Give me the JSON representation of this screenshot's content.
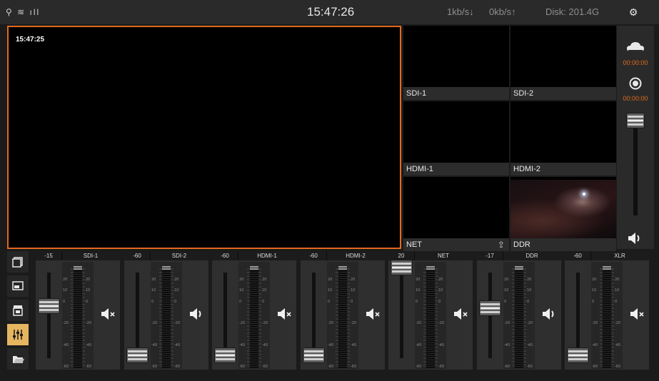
{
  "status_bar": {
    "clock": "15:47:26",
    "download": "1kb/s↓",
    "upload": "0kb/s↑",
    "disk": "Disk: 201.4G",
    "left_icons": "⚲ ≋ ıll"
  },
  "program": {
    "timestamp": "15:47:25",
    "border_color": "#e06a1f"
  },
  "sources": [
    {
      "label": "SDI-1"
    },
    {
      "label": "SDI-2"
    },
    {
      "label": "HDMI-1"
    },
    {
      "label": "HDMI-2"
    },
    {
      "label": "NET",
      "icon": "upload-icon"
    },
    {
      "label": "DDR"
    }
  ],
  "right_panel": {
    "stream_time": "00:00:00",
    "record_time": "00:00:00",
    "master_volume": "unmuted"
  },
  "tools": [
    {
      "icon": "multiview-icon"
    },
    {
      "icon": "pip-icon"
    },
    {
      "icon": "clapper-icon"
    },
    {
      "icon": "mixer-icon",
      "active": true
    },
    {
      "icon": "folder-icon"
    }
  ],
  "mixer": {
    "scale_labels": [
      "20",
      "10",
      "0",
      "-20",
      "-40",
      "-60"
    ],
    "channels": [
      {
        "name": "SDI-1",
        "level": "-15",
        "fader": -15,
        "muted": true
      },
      {
        "name": "SDI-2",
        "level": "-60",
        "fader": -60,
        "muted": false
      },
      {
        "name": "HDMI-1",
        "level": "-60",
        "fader": -60,
        "muted": true
      },
      {
        "name": "HDMI-2",
        "level": "-60",
        "fader": -60,
        "muted": true
      },
      {
        "name": "NET",
        "level": "20",
        "fader": 20,
        "muted": true
      },
      {
        "name": "DDR",
        "level": "-17",
        "fader": -17,
        "muted": false
      },
      {
        "name": "XLR",
        "level": "-60",
        "fader": -60,
        "muted": true
      }
    ]
  },
  "colors": {
    "accent": "#e06a1f",
    "active_tool": "#e5b560"
  }
}
